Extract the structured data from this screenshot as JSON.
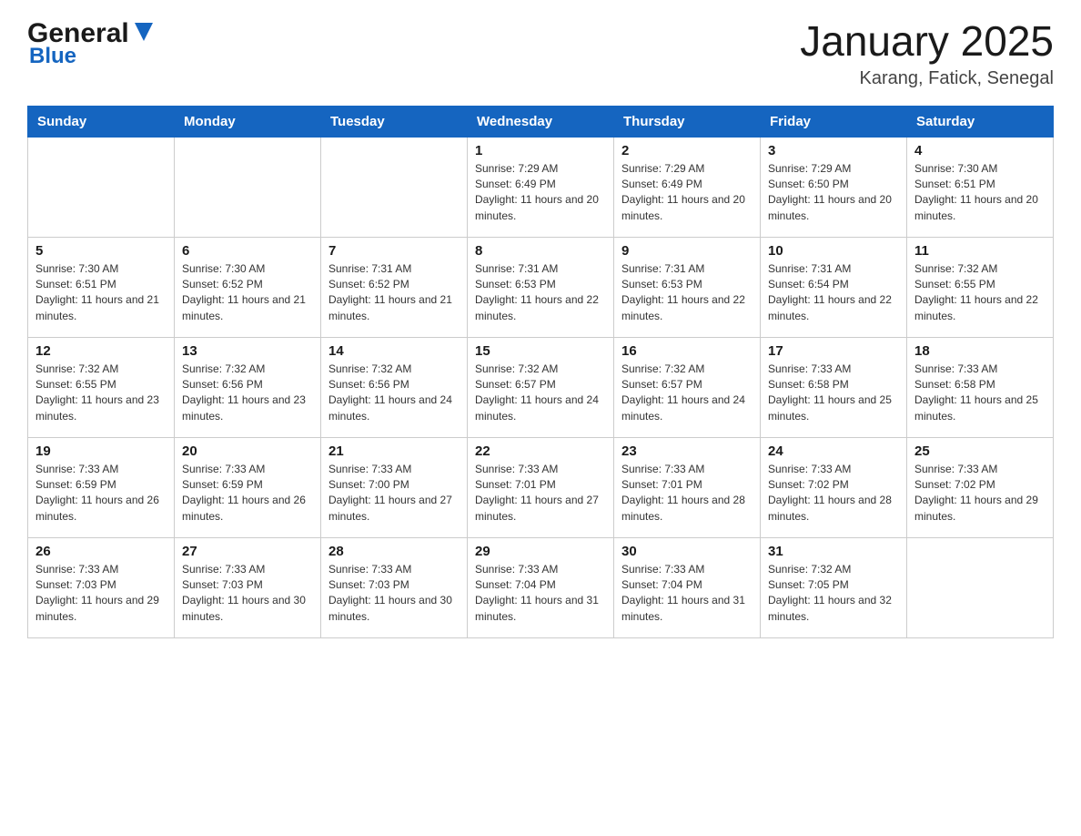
{
  "header": {
    "logo_general": "General",
    "logo_blue": "Blue",
    "month_title": "January 2025",
    "location": "Karang, Fatick, Senegal"
  },
  "days_of_week": [
    "Sunday",
    "Monday",
    "Tuesday",
    "Wednesday",
    "Thursday",
    "Friday",
    "Saturday"
  ],
  "weeks": [
    [
      {
        "day": "",
        "info": ""
      },
      {
        "day": "",
        "info": ""
      },
      {
        "day": "",
        "info": ""
      },
      {
        "day": "1",
        "info": "Sunrise: 7:29 AM\nSunset: 6:49 PM\nDaylight: 11 hours and 20 minutes."
      },
      {
        "day": "2",
        "info": "Sunrise: 7:29 AM\nSunset: 6:49 PM\nDaylight: 11 hours and 20 minutes."
      },
      {
        "day": "3",
        "info": "Sunrise: 7:29 AM\nSunset: 6:50 PM\nDaylight: 11 hours and 20 minutes."
      },
      {
        "day": "4",
        "info": "Sunrise: 7:30 AM\nSunset: 6:51 PM\nDaylight: 11 hours and 20 minutes."
      }
    ],
    [
      {
        "day": "5",
        "info": "Sunrise: 7:30 AM\nSunset: 6:51 PM\nDaylight: 11 hours and 21 minutes."
      },
      {
        "day": "6",
        "info": "Sunrise: 7:30 AM\nSunset: 6:52 PM\nDaylight: 11 hours and 21 minutes."
      },
      {
        "day": "7",
        "info": "Sunrise: 7:31 AM\nSunset: 6:52 PM\nDaylight: 11 hours and 21 minutes."
      },
      {
        "day": "8",
        "info": "Sunrise: 7:31 AM\nSunset: 6:53 PM\nDaylight: 11 hours and 22 minutes."
      },
      {
        "day": "9",
        "info": "Sunrise: 7:31 AM\nSunset: 6:53 PM\nDaylight: 11 hours and 22 minutes."
      },
      {
        "day": "10",
        "info": "Sunrise: 7:31 AM\nSunset: 6:54 PM\nDaylight: 11 hours and 22 minutes."
      },
      {
        "day": "11",
        "info": "Sunrise: 7:32 AM\nSunset: 6:55 PM\nDaylight: 11 hours and 22 minutes."
      }
    ],
    [
      {
        "day": "12",
        "info": "Sunrise: 7:32 AM\nSunset: 6:55 PM\nDaylight: 11 hours and 23 minutes."
      },
      {
        "day": "13",
        "info": "Sunrise: 7:32 AM\nSunset: 6:56 PM\nDaylight: 11 hours and 23 minutes."
      },
      {
        "day": "14",
        "info": "Sunrise: 7:32 AM\nSunset: 6:56 PM\nDaylight: 11 hours and 24 minutes."
      },
      {
        "day": "15",
        "info": "Sunrise: 7:32 AM\nSunset: 6:57 PM\nDaylight: 11 hours and 24 minutes."
      },
      {
        "day": "16",
        "info": "Sunrise: 7:32 AM\nSunset: 6:57 PM\nDaylight: 11 hours and 24 minutes."
      },
      {
        "day": "17",
        "info": "Sunrise: 7:33 AM\nSunset: 6:58 PM\nDaylight: 11 hours and 25 minutes."
      },
      {
        "day": "18",
        "info": "Sunrise: 7:33 AM\nSunset: 6:58 PM\nDaylight: 11 hours and 25 minutes."
      }
    ],
    [
      {
        "day": "19",
        "info": "Sunrise: 7:33 AM\nSunset: 6:59 PM\nDaylight: 11 hours and 26 minutes."
      },
      {
        "day": "20",
        "info": "Sunrise: 7:33 AM\nSunset: 6:59 PM\nDaylight: 11 hours and 26 minutes."
      },
      {
        "day": "21",
        "info": "Sunrise: 7:33 AM\nSunset: 7:00 PM\nDaylight: 11 hours and 27 minutes."
      },
      {
        "day": "22",
        "info": "Sunrise: 7:33 AM\nSunset: 7:01 PM\nDaylight: 11 hours and 27 minutes."
      },
      {
        "day": "23",
        "info": "Sunrise: 7:33 AM\nSunset: 7:01 PM\nDaylight: 11 hours and 28 minutes."
      },
      {
        "day": "24",
        "info": "Sunrise: 7:33 AM\nSunset: 7:02 PM\nDaylight: 11 hours and 28 minutes."
      },
      {
        "day": "25",
        "info": "Sunrise: 7:33 AM\nSunset: 7:02 PM\nDaylight: 11 hours and 29 minutes."
      }
    ],
    [
      {
        "day": "26",
        "info": "Sunrise: 7:33 AM\nSunset: 7:03 PM\nDaylight: 11 hours and 29 minutes."
      },
      {
        "day": "27",
        "info": "Sunrise: 7:33 AM\nSunset: 7:03 PM\nDaylight: 11 hours and 30 minutes."
      },
      {
        "day": "28",
        "info": "Sunrise: 7:33 AM\nSunset: 7:03 PM\nDaylight: 11 hours and 30 minutes."
      },
      {
        "day": "29",
        "info": "Sunrise: 7:33 AM\nSunset: 7:04 PM\nDaylight: 11 hours and 31 minutes."
      },
      {
        "day": "30",
        "info": "Sunrise: 7:33 AM\nSunset: 7:04 PM\nDaylight: 11 hours and 31 minutes."
      },
      {
        "day": "31",
        "info": "Sunrise: 7:32 AM\nSunset: 7:05 PM\nDaylight: 11 hours and 32 minutes."
      },
      {
        "day": "",
        "info": ""
      }
    ]
  ]
}
